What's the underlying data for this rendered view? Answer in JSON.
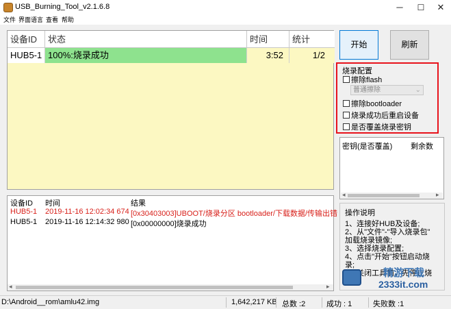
{
  "window": {
    "title": "USB_Burning_Tool_v2.1.6.8",
    "minimize": "─",
    "maximize": "☐",
    "close": "✕"
  },
  "menu": [
    "文件",
    "界面语言",
    "查看",
    "帮助"
  ],
  "device_table": {
    "headers": [
      "设备ID",
      "状态",
      "时间",
      "统计"
    ],
    "rows": [
      {
        "id": "HUB5-1",
        "status": "100%:烧录成功",
        "time": "3:52",
        "count": "1/2"
      }
    ]
  },
  "buttons": {
    "start": "开始",
    "refresh": "刷新"
  },
  "burn_config": {
    "title": "烧录配置",
    "erase_flash": "擦除flash",
    "erase_mode": "普通擦除",
    "erase_bootloader": "擦除bootloader",
    "reset_after": "烧录成功后重启设备",
    "overwrite_key": "是否覆盖烧录密钥"
  },
  "key_table": {
    "headers": [
      "密钥(是否覆盖)",
      "剩余数"
    ]
  },
  "log": {
    "headers": [
      "设备ID",
      "时间",
      "结果"
    ],
    "rows": [
      {
        "id": "HUB5-1",
        "time": "2019-11-16 12:02:34 674",
        "result": "[0x30403003]UBOOT/烧录分区 bootloader/下载数据/传输出错",
        "color": "#d8201a"
      },
      {
        "id": "HUB5-1",
        "time": "2019-11-16 12:14:32 980",
        "result": "[0x00000000]烧录成功",
        "color": "#000000"
      }
    ]
  },
  "instructions": {
    "title": "操作说明",
    "lines": [
      "1、连接好HUB及设备;",
      "2、从\"文件\"-\"导入烧录包\"",
      "加载烧录镜像;",
      "3、选择烧录配置;",
      "4、点击\"开始\"按钮启动烧",
      "录;",
      "5、关闭工具前，先停止烧"
    ]
  },
  "watermark": {
    "line1": "精游下载",
    "line2": "2333it.com"
  },
  "statusbar": {
    "path": "D:\\Android__rom\\amlu42.img",
    "size": "1,642,217 KB",
    "total": "总数 :2",
    "success": "成功 : 1",
    "fail": "失败数 :1"
  }
}
